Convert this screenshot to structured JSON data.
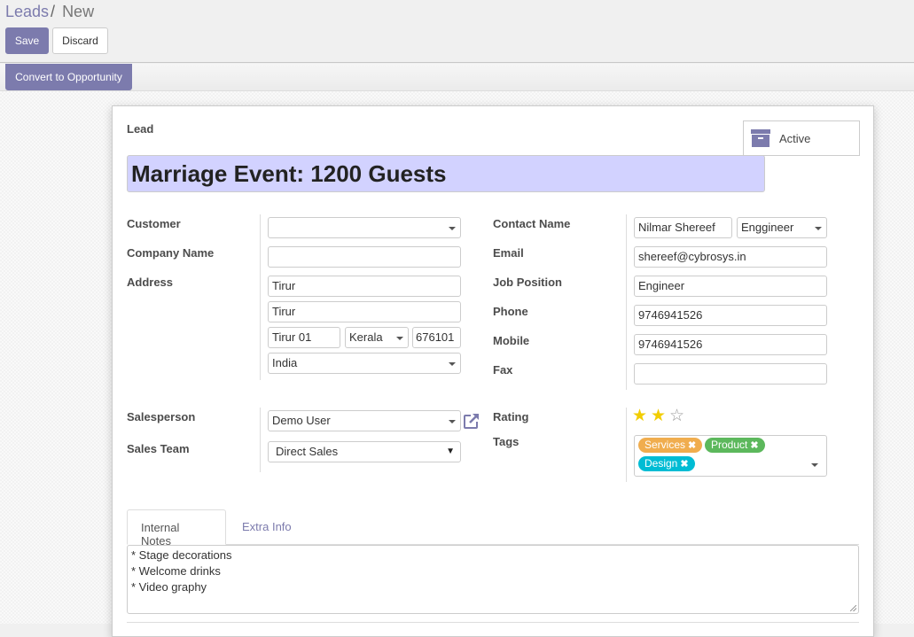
{
  "breadcrumb": {
    "parent": "Leads",
    "separator": "/",
    "current": "New"
  },
  "toolbar": {
    "save_label": "Save",
    "discard_label": "Discard"
  },
  "statusbar": {
    "convert_label": "Convert to Opportunity"
  },
  "button_box": {
    "active_label": "Active",
    "icon": "archive-icon"
  },
  "lead": {
    "section_label": "Lead",
    "title": "Marriage Event: 1200 Guests"
  },
  "left_fields": {
    "customer": {
      "label": "Customer",
      "value": ""
    },
    "company_name": {
      "label": "Company Name",
      "value": ""
    },
    "address": {
      "label": "Address",
      "street": "Tirur",
      "street2": "Tirur",
      "city": "Tirur 01",
      "state": "Kerala",
      "zip": "676101",
      "country": "India"
    },
    "salesperson": {
      "label": "Salesperson",
      "value": "Demo User",
      "external_link_icon": "external-link-icon"
    },
    "sales_team": {
      "label": "Sales Team",
      "value": "Direct Sales"
    }
  },
  "right_fields": {
    "contact_name": {
      "label": "Contact Name",
      "value": "Nilmar Shereef",
      "title": "Enggineer"
    },
    "email": {
      "label": "Email",
      "value": "shereef@cybrosys.in"
    },
    "job_position": {
      "label": "Job Position",
      "value": "Engineer"
    },
    "phone": {
      "label": "Phone",
      "value": "9746941526"
    },
    "mobile": {
      "label": "Mobile",
      "value": "9746941526"
    },
    "fax": {
      "label": "Fax",
      "value": ""
    },
    "rating": {
      "label": "Rating",
      "value": 2,
      "max": 3
    },
    "tags": {
      "label": "Tags",
      "items": [
        {
          "name": "Services",
          "color": "#f0ad4e"
        },
        {
          "name": "Product",
          "color": "#5cb85c"
        },
        {
          "name": "Design",
          "color": "#00bcd4"
        }
      ]
    }
  },
  "notebook": {
    "tabs": [
      {
        "label": "Internal Notes",
        "active": true
      },
      {
        "label": "Extra Info",
        "active": false
      }
    ],
    "notes_lines": [
      "* Stage decorations",
      "* Welcome drinks",
      "* Video graphy"
    ]
  },
  "colors": {
    "primary": "#7c7bad",
    "title_bg": "#d2d2ff",
    "star": "#f2cd00"
  }
}
